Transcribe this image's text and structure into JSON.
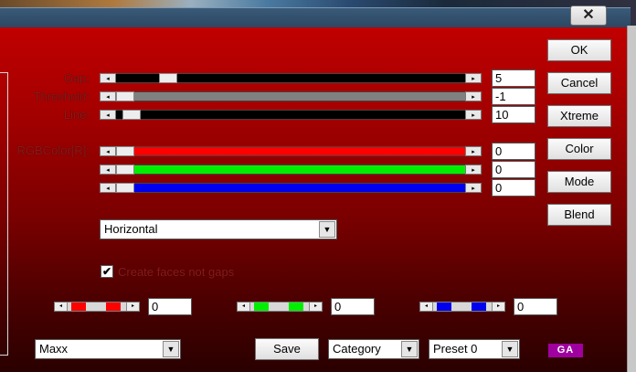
{
  "window": {
    "close_glyph": "✕"
  },
  "sliders": [
    {
      "label": "Gap:",
      "value": "5",
      "fill": "#000000",
      "thumb_pct": 0.13
    },
    {
      "label": "Threshold:",
      "value": "-1",
      "fill": "#808080",
      "thumb_pct": 0.0
    },
    {
      "label": "Line:",
      "value": "10",
      "fill": "#000000",
      "thumb_pct": 0.02
    },
    {
      "label": "RGBColor[R]:",
      "value": "0",
      "fill": "#ff0000",
      "thumb_pct": 0.0
    },
    {
      "label": "",
      "value": "0",
      "fill": "#00ee00",
      "thumb_pct": 0.0
    },
    {
      "label": "",
      "value": "0",
      "fill": "#0000ee",
      "thumb_pct": 0.0
    }
  ],
  "buttons": {
    "ok": "OK",
    "cancel": "Cancel",
    "xtreme": "Xtreme",
    "color": "Color",
    "mode": "Mode",
    "blend": "Blend",
    "save": "Save"
  },
  "orientation_select": {
    "value": "Horizontal"
  },
  "checkbox": {
    "label": "Create faces not gaps",
    "checked": true,
    "glyph": "✔"
  },
  "mini_sliders": [
    {
      "color": "#ff0000",
      "value": "0"
    },
    {
      "color": "#00ee00",
      "value": "0"
    },
    {
      "color": "#0000ee",
      "value": "0"
    }
  ],
  "footer": {
    "effect_select": "Maxx",
    "category_select": "Category",
    "preset_select": "Preset 0",
    "logo": "GA"
  },
  "glyphs": {
    "left": "◂",
    "right": "▸",
    "down": "▼"
  }
}
